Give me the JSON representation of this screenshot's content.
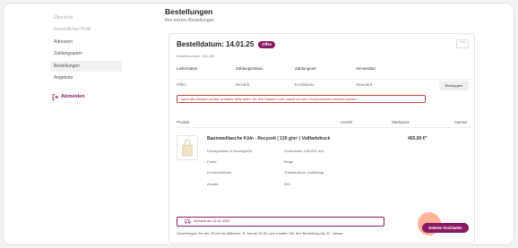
{
  "sidebar": {
    "items": [
      {
        "label": "Übersicht",
        "faded": true
      },
      {
        "label": "Persönliches Profil",
        "faded": true
      },
      {
        "label": "Adressen",
        "faded": false
      },
      {
        "label": "Zahlungsarten",
        "faded": false
      },
      {
        "label": "Bestellungen",
        "faded": false,
        "active": true
      },
      {
        "label": "Angebote",
        "faded": false
      }
    ],
    "logout_label": "Abmelden"
  },
  "main": {
    "title": "Bestellungen",
    "subtitle": "Ihre letzten Bestellungen"
  },
  "order": {
    "title": "Bestelldatum: 14.01.25",
    "status_badge": "Offen",
    "number": "Bestellnummer: 051335",
    "status_headers": [
      "Lieferstatus",
      "Zahlungsstatus",
      "Zahlungsart",
      "Versandart"
    ],
    "status_values": [
      "Offen",
      "Bezahlt",
      "Kreditkarte",
      "Standard"
    ],
    "collapse_label": "Einklappen",
    "warning": "Nicht alle Dateien wurden erhalten. Bitte laden Sie Ihre Dateien hoch, damit wir eine Druckvorschau erstellen können",
    "product_headers": {
      "product": "Produkt",
      "qty": "Anzahl",
      "unit_price": "Stückpreis",
      "sum": "Summe"
    },
    "product": {
      "title": "Baumwolltasche Köln - Recycelt | 130 g/m² | Vollfarbdruck",
      "price": "455,00 €*",
      "specs": [
        {
          "key": "Druckposition & Druckgröße:",
          "value": "Vorderseite 140x200 mm"
        },
        {
          "key": "Farbe:",
          "value": "Beige"
        },
        {
          "key": "Druckverfahren:",
          "value": "Transferdruck (vollfarbig)"
        },
        {
          "key": "Anzahl:",
          "value": "250"
        }
      ]
    },
    "shipping_badge": "Versand am 02.01.2025",
    "note": "Genehmigen Sie den Proof bis Mittwoch, 8. Januar 00:00 und erhalten Sie Ihre Bestellung bis 22. Januar.",
    "upload_label": "Dateien hochladen"
  },
  "colors": {
    "accent": "#8a1a63",
    "warning": "#c6443a",
    "highlight": "#ff9978"
  }
}
